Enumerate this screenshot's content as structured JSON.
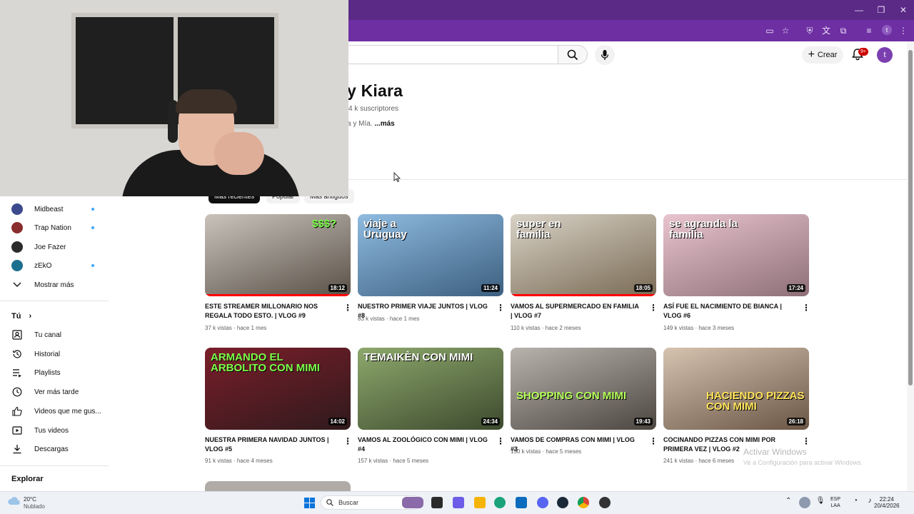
{
  "header": {
    "create_label": "Crear",
    "notif_badge": "9+",
    "avatar_letter": "t",
    "profile_letter": "t"
  },
  "channel": {
    "name": "y Kiara",
    "subscribers": "4 k suscriptores",
    "description": "a y Mía.",
    "more": "...más"
  },
  "chips": [
    {
      "label": "Más recientes",
      "active": true
    },
    {
      "label": "Popular",
      "active": false
    },
    {
      "label": "Más antiguos",
      "active": false
    }
  ],
  "sidebar": {
    "subscriptions": [
      {
        "name": "Midbeast",
        "color": "#3b4a8c",
        "live": true
      },
      {
        "name": "Trap Nation",
        "color": "#8a2d2d",
        "live": true
      },
      {
        "name": "Joe Fazer",
        "color": "#2b2b2b",
        "live": false
      },
      {
        "name": "zEkO",
        "color": "#1d6f8f",
        "live": true
      }
    ],
    "show_more": "Mostrar más",
    "you_heading": "Tú",
    "you_items": [
      "Tu canal",
      "Historial",
      "Playlists",
      "Ver más tarde",
      "Videos que me gus...",
      "Tus videos",
      "Descargas"
    ],
    "explore_heading": "Explorar"
  },
  "videos": [
    {
      "title": "ESTE STREAMER MILLONARIO NOS REGALA TODO ESTO. | VLOG #9",
      "views": "37 k vistas",
      "age": "hace 1 mes",
      "duration": "18:12",
      "thumb_text": "$$$?",
      "bg1": "#c9c3bb",
      "bg2": "#5a5148"
    },
    {
      "title": "NUESTRO PRIMER VIAJE JUNTOS | VLOG #8",
      "views": "83 k vistas",
      "age": "hace 1 mes",
      "duration": "11:24",
      "thumb_text": "viaje a Uruguay",
      "bg1": "#8fbbe0",
      "bg2": "#3c5f7f"
    },
    {
      "title": "VAMOS AL SUPERMERCADO EN FAMILIA | VLOG #7",
      "views": "110 k vistas",
      "age": "hace 2 meses",
      "duration": "18:05",
      "thumb_text": "super en familia",
      "bg1": "#d8d2c6",
      "bg2": "#7a6b55"
    },
    {
      "title": "ASÍ FUE EL NACIMIENTO DE BIANCA | VLOG #6",
      "views": "149 k vistas",
      "age": "hace 3 meses",
      "duration": "17:24",
      "thumb_text": "se agranda la familia",
      "bg1": "#e8c4cf",
      "bg2": "#8e6f77"
    },
    {
      "title": "NUESTRA PRIMERA NAVIDAD JUNTOS | VLOG #5",
      "views": "91 k vistas",
      "age": "hace 4 meses",
      "duration": "14:02",
      "thumb_text": "ARMANDO EL ARBOLITO CON MIMI",
      "bg1": "#7a1e2a",
      "bg2": "#2f1a1c"
    },
    {
      "title": "VAMOS AL ZOOLÓGICO CON MIMI | VLOG #4",
      "views": "157 k vistas",
      "age": "hace 5 meses",
      "duration": "24:34",
      "thumb_text": "TEMAIKÈN CON MIMI",
      "bg1": "#8da86c",
      "bg2": "#3d4a2e"
    },
    {
      "title": "VAMOS DE COMPRAS CON MIMI | VLOG #3",
      "views": "150 k vistas",
      "age": "hace 5 meses",
      "duration": "19:43",
      "thumb_text": "SHOPPING CON MIMI",
      "bg1": "#b9b3ad",
      "bg2": "#4c4640"
    },
    {
      "title": "COCINANDO PIZZAS CON MIMI POR PRIMERA VEZ | VLOG #2",
      "views": "241 k vistas",
      "age": "hace 6 meses",
      "duration": "26:18",
      "thumb_text": "HACIENDO PIZZAS CON MIMI",
      "bg1": "#d6c3b0",
      "bg2": "#6b5645"
    }
  ],
  "watermark": {
    "line1": "Activar Windows",
    "line2": "Ve a Configuración para activar Windows."
  },
  "taskbar": {
    "temp": "20°C",
    "weather": "Nublado",
    "search_placeholder": "Buscar",
    "lang1": "ESP",
    "lang2": "LAA",
    "time": "22:24",
    "date": "20/4/2026"
  }
}
